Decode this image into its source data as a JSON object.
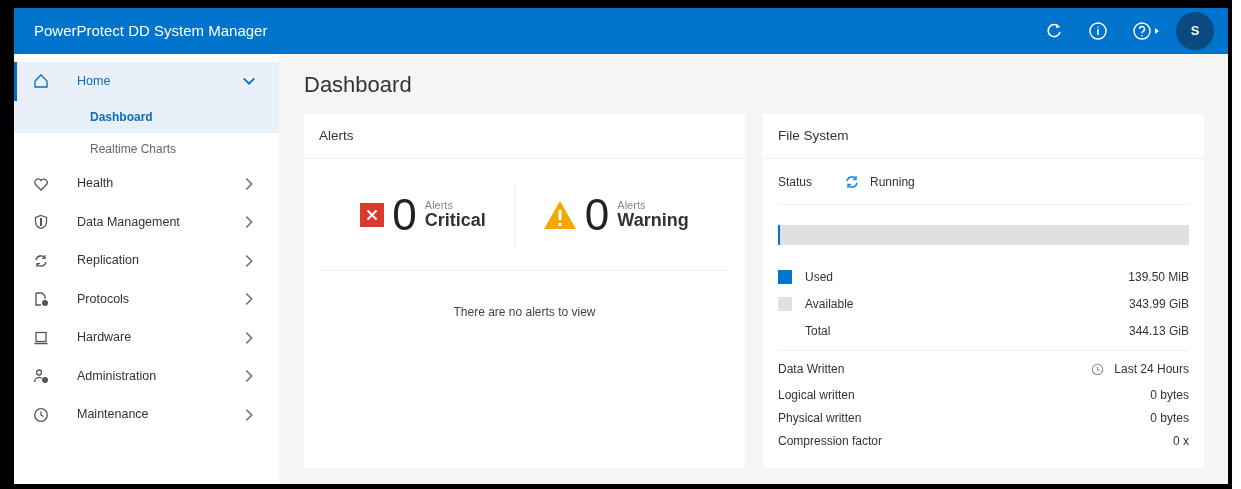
{
  "header": {
    "title": "PowerProtect DD System Manager",
    "avatar": "S"
  },
  "sidebar": {
    "items": [
      {
        "label": "Home",
        "selected": true,
        "expanded": true,
        "children": [
          {
            "label": "Dashboard",
            "selected": true
          },
          {
            "label": "Realtime Charts",
            "selected": false
          }
        ]
      },
      {
        "label": "Health",
        "selected": false,
        "expanded": false
      },
      {
        "label": "Data Management",
        "selected": false,
        "expanded": false
      },
      {
        "label": "Replication",
        "selected": false,
        "expanded": false
      },
      {
        "label": "Protocols",
        "selected": false,
        "expanded": false
      },
      {
        "label": "Hardware",
        "selected": false,
        "expanded": false
      },
      {
        "label": "Administration",
        "selected": false,
        "expanded": false
      },
      {
        "label": "Maintenance",
        "selected": false,
        "expanded": false
      }
    ]
  },
  "page_title": "Dashboard",
  "alerts": {
    "title": "Alerts",
    "counters": [
      {
        "kind": "critical",
        "count": "0",
        "caption": "Alerts",
        "label": "Critical"
      },
      {
        "kind": "warning",
        "count": "0",
        "caption": "Alerts",
        "label": "Warning"
      }
    ],
    "empty_message": "There are no alerts to view"
  },
  "file_system": {
    "title": "File System",
    "status_label": "Status",
    "status": "Running",
    "usage": {
      "level": 0.004
    },
    "legend": [
      {
        "label": "Used",
        "value": "139.50 MiB",
        "color": "#0076ce"
      },
      {
        "label": "Available",
        "value": "343.99 GiB",
        "color": "#e0e0e0"
      },
      {
        "label": "Total",
        "value": "344.13 GiB"
      }
    ],
    "data_written": {
      "label": "Data Written",
      "period": "Last 24 Hours",
      "rows": [
        {
          "label": "Logical written",
          "value": "0 bytes"
        },
        {
          "label": "Physical written",
          "value": "0 bytes"
        },
        {
          "label": "Compression factor",
          "value": "0 x"
        }
      ]
    }
  }
}
